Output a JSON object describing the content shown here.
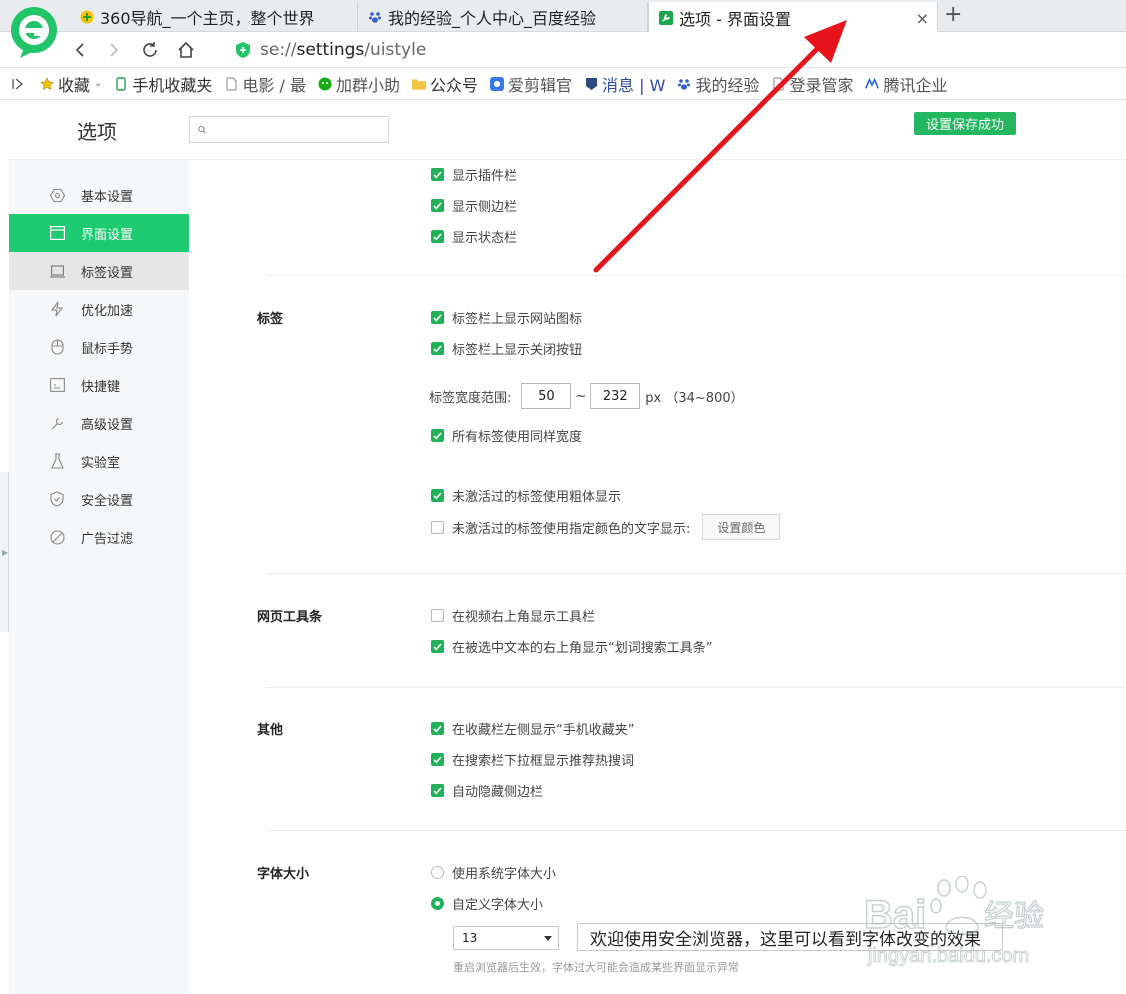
{
  "browser": {
    "tabs": [
      {
        "label": "360导航_一个主页，整个世界",
        "icon": "360-nav-icon"
      },
      {
        "label": "我的经验_个人中心_百度经验",
        "icon": "baidu-paw-icon"
      },
      {
        "label": "选项 - 界面设置",
        "icon": "settings-wrench-icon",
        "active": true
      }
    ],
    "new_tab": "+",
    "close": "×",
    "address": {
      "prefix": "se://",
      "highlight": "settings",
      "suffix": "/uistyle"
    },
    "bookmarks": [
      {
        "label": "收藏",
        "icon": "star-icon"
      },
      {
        "label": "手机收藏夹",
        "icon": "phone-icon"
      },
      {
        "label": "电影 / 最",
        "icon": "page-icon"
      },
      {
        "label": "加群小助",
        "icon": "wechat-icon"
      },
      {
        "label": "公众号",
        "icon": "folder-icon"
      },
      {
        "label": "爱剪辑官",
        "icon": "app-icon"
      },
      {
        "label": "消息 | W",
        "icon": "badge-icon"
      },
      {
        "label": "我的经验",
        "icon": "baidu-paw-icon"
      },
      {
        "label": "登录管家",
        "icon": "page-icon"
      },
      {
        "label": "腾讯企业",
        "icon": "tencent-icon"
      }
    ]
  },
  "header": {
    "title": "选项",
    "search_placeholder": "",
    "save_status": "设置保存成功"
  },
  "sidebar": {
    "items": [
      {
        "label": "基本设置"
      },
      {
        "label": "界面设置"
      },
      {
        "label": "标签设置"
      },
      {
        "label": "优化加速"
      },
      {
        "label": "鼠标手势"
      },
      {
        "label": "快捷键"
      },
      {
        "label": "高级设置"
      },
      {
        "label": "实验室"
      },
      {
        "label": "安全设置"
      },
      {
        "label": "广告过滤"
      }
    ]
  },
  "display": {
    "options": [
      {
        "label": "显示插件栏",
        "checked": true
      },
      {
        "label": "显示侧边栏",
        "checked": true
      },
      {
        "label": "显示状态栏",
        "checked": true
      }
    ]
  },
  "tabs_section": {
    "title": "标签",
    "show_site_icon": "标签栏上显示网站图标",
    "show_close_button": "标签栏上显示关闭按钮",
    "width_label": "标签宽度范围:",
    "width_min": "50",
    "width_sep": "~",
    "width_max": "232",
    "width_unit": "px （34~800）",
    "same_width": "所有标签使用同样宽度",
    "inactive_bold": "未激活过的标签使用粗体显示",
    "inactive_color": "未激活过的标签使用指定颜色的文字显示:",
    "color_button": "设置颜色"
  },
  "toolbar_section": {
    "title": "网页工具条",
    "video_toolbar": "在视频右上角显示工具栏",
    "selection_toolbar": "在被选中文本的右上角显示“划词搜索工具条”"
  },
  "other_section": {
    "title": "其他",
    "mobile_favorites": "在收藏栏左侧显示“手机收藏夹”",
    "hot_search": "在搜索栏下拉框显示推荐热搜词",
    "auto_hide_sidebar": "自动隐藏侧边栏"
  },
  "font_section": {
    "title": "字体大小",
    "system_size": "使用系统字体大小",
    "custom_size": "自定义字体大小",
    "size_value": "13",
    "preview_text": "欢迎使用安全浏览器，这里可以看到字体改变的效果",
    "hint": "重启浏览器后生效，字体过大可能会造成某些界面显示异常"
  },
  "watermark": {
    "text": "Bai",
    "suffix": "经验",
    "url": "jingyan.baidu.com"
  },
  "colors": {
    "accent": "#1fcb70",
    "checkbox": "#20b15a",
    "annotation": "#e8141c"
  }
}
